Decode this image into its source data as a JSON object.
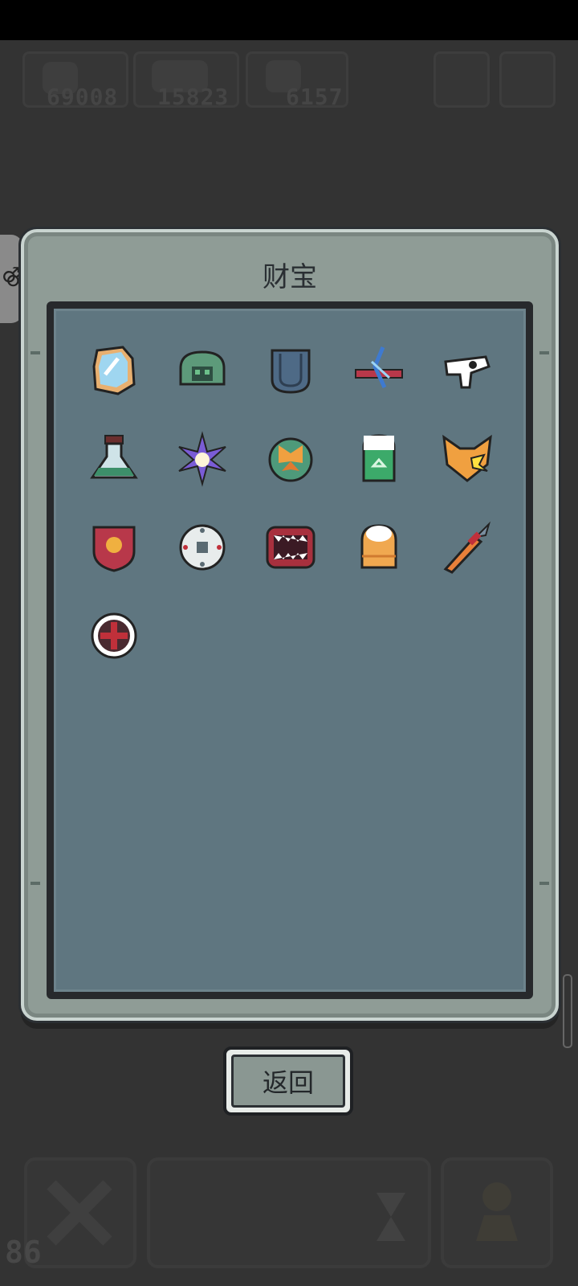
{
  "hud": {
    "resource_1": "69008",
    "resource_2": "15823",
    "resource_3": "6157",
    "level": "86"
  },
  "panel": {
    "title": "财宝"
  },
  "items": [
    {
      "name": "mirror-treasure"
    },
    {
      "name": "green-helmet-treasure"
    },
    {
      "name": "blue-pocket-treasure"
    },
    {
      "name": "crossbow-treasure"
    },
    {
      "name": "eye-glyph-treasure"
    },
    {
      "name": "potion-flask-treasure"
    },
    {
      "name": "purple-star-treasure"
    },
    {
      "name": "butterfly-orb-treasure"
    },
    {
      "name": "green-jar-treasure"
    },
    {
      "name": "fox-mask-treasure"
    },
    {
      "name": "red-shield-treasure"
    },
    {
      "name": "white-gear-treasure"
    },
    {
      "name": "monster-mouth-treasure"
    },
    {
      "name": "orange-bag-treasure"
    },
    {
      "name": "dagger-treasure"
    },
    {
      "name": "red-cross-medal-treasure"
    }
  ],
  "buttons": {
    "back_label": "返回"
  },
  "colors": {
    "panel": "#8f9c96",
    "inner": "#5f7680",
    "background": "#333333"
  }
}
